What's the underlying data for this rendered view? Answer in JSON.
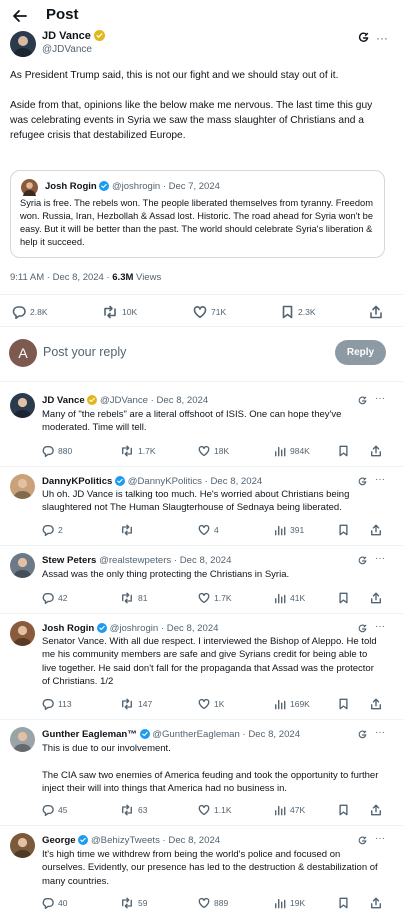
{
  "header": {
    "title": "Post"
  },
  "main_post": {
    "name": "JD Vance",
    "handle": "@JDVance",
    "text": [
      "As President Trump said, this is not our fight and we should stay out of it.",
      "Aside from that, opinions like the below make me nervous. The last time this guy was celebrating events in Syria we saw the mass slaughter of Christians and a refugee crisis that destabilized Europe."
    ],
    "quote": {
      "name": "Josh Rogin",
      "handle": "@joshrogin",
      "date": "· Dec 7, 2024",
      "text": "Syria is free. The rebels won. The people liberated themselves from tyranny. Freedom won. Russia, Iran, Hezbollah & Assad lost. Historic. The road ahead for Syria won't be easy. But it will be better than the past. The world should celebrate Syria's liberation & help it succeed."
    },
    "time": "9:11 AM · Dec 8, 2024 · ",
    "views_count": "6.3M",
    "views_label": " Views",
    "actions": {
      "replies": "2.8K",
      "reposts": "10K",
      "likes": "71K",
      "bookmarks": "2.3K"
    }
  },
  "reply_box": {
    "avatar_letter": "A",
    "placeholder": "Post your reply",
    "button": "Reply"
  },
  "replies": [
    {
      "name": "JD Vance",
      "handle": "@JDVance · Dec 8, 2024",
      "verified": "gold",
      "text": [
        "Many of \"the rebels\" are a literal offshoot of ISIS. One can hope they've moderated. Time will tell."
      ],
      "replies": "880",
      "reposts": "1.7K",
      "likes": "18K",
      "views": "984K",
      "avatar_color": "#2b3a4c"
    },
    {
      "name": "DannyKPolitics",
      "handle": "@DannyKPolitics · Dec 8, 2024",
      "verified": "blue",
      "text": [
        "Uh oh. JD Vance is talking too much. He's worried about Christians being slaughtered not The Human Slaugterhouse of Sednaya being liberated."
      ],
      "replies": "2",
      "reposts": "",
      "likes": "4",
      "views": "391",
      "avatar_color": "#c9a27a"
    },
    {
      "name": "Stew Peters",
      "handle": "@realstewpeters · Dec 8, 2024",
      "verified": "none",
      "text": [
        "Assad was the only thing protecting the Christians in Syria."
      ],
      "replies": "42",
      "reposts": "81",
      "likes": "1.7K",
      "views": "41K",
      "avatar_color": "#6b7a86"
    },
    {
      "name": "Josh Rogin",
      "handle": "@joshrogin · Dec 8, 2024",
      "verified": "blue",
      "text": [
        "Senator Vance. With all due respect. I interviewed the Bishop of Aleppo. He told me his community members are safe and give Syrians credit for being able to live together. He said don't fall for the propaganda that Assad was the protector of Christians. 1/2"
      ],
      "replies": "113",
      "reposts": "147",
      "likes": "1K",
      "views": "169K",
      "avatar_color": "#8a5a3c"
    },
    {
      "name": "Gunther Eagleman™",
      "handle": "@GuntherEagleman · Dec 8, 2024",
      "verified": "blue",
      "text": [
        "This is due to our involvement.",
        "The CIA saw two enemies of America feuding and took the opportunity to further inject their will into things that America had no business in."
      ],
      "replies": "45",
      "reposts": "63",
      "likes": "1.1K",
      "views": "47K",
      "avatar_color": "#9aa3a8"
    },
    {
      "name": "George",
      "handle": "@BehizyTweets · Dec 8, 2024",
      "verified": "blue",
      "text": [
        "It's high time we withdrew from being the world's police and focused on ourselves. Evidently, our presence has led to the destruction & destabilization of many countries."
      ],
      "replies": "40",
      "reposts": "59",
      "likes": "889",
      "views": "19K",
      "avatar_color": "#7a5a3a"
    }
  ],
  "colors": {
    "accent_blue": "#1d9bf0",
    "gold_check": "#e2b719",
    "text": "#0f1419",
    "secondary": "#536471",
    "divider": "#eff3f4"
  }
}
